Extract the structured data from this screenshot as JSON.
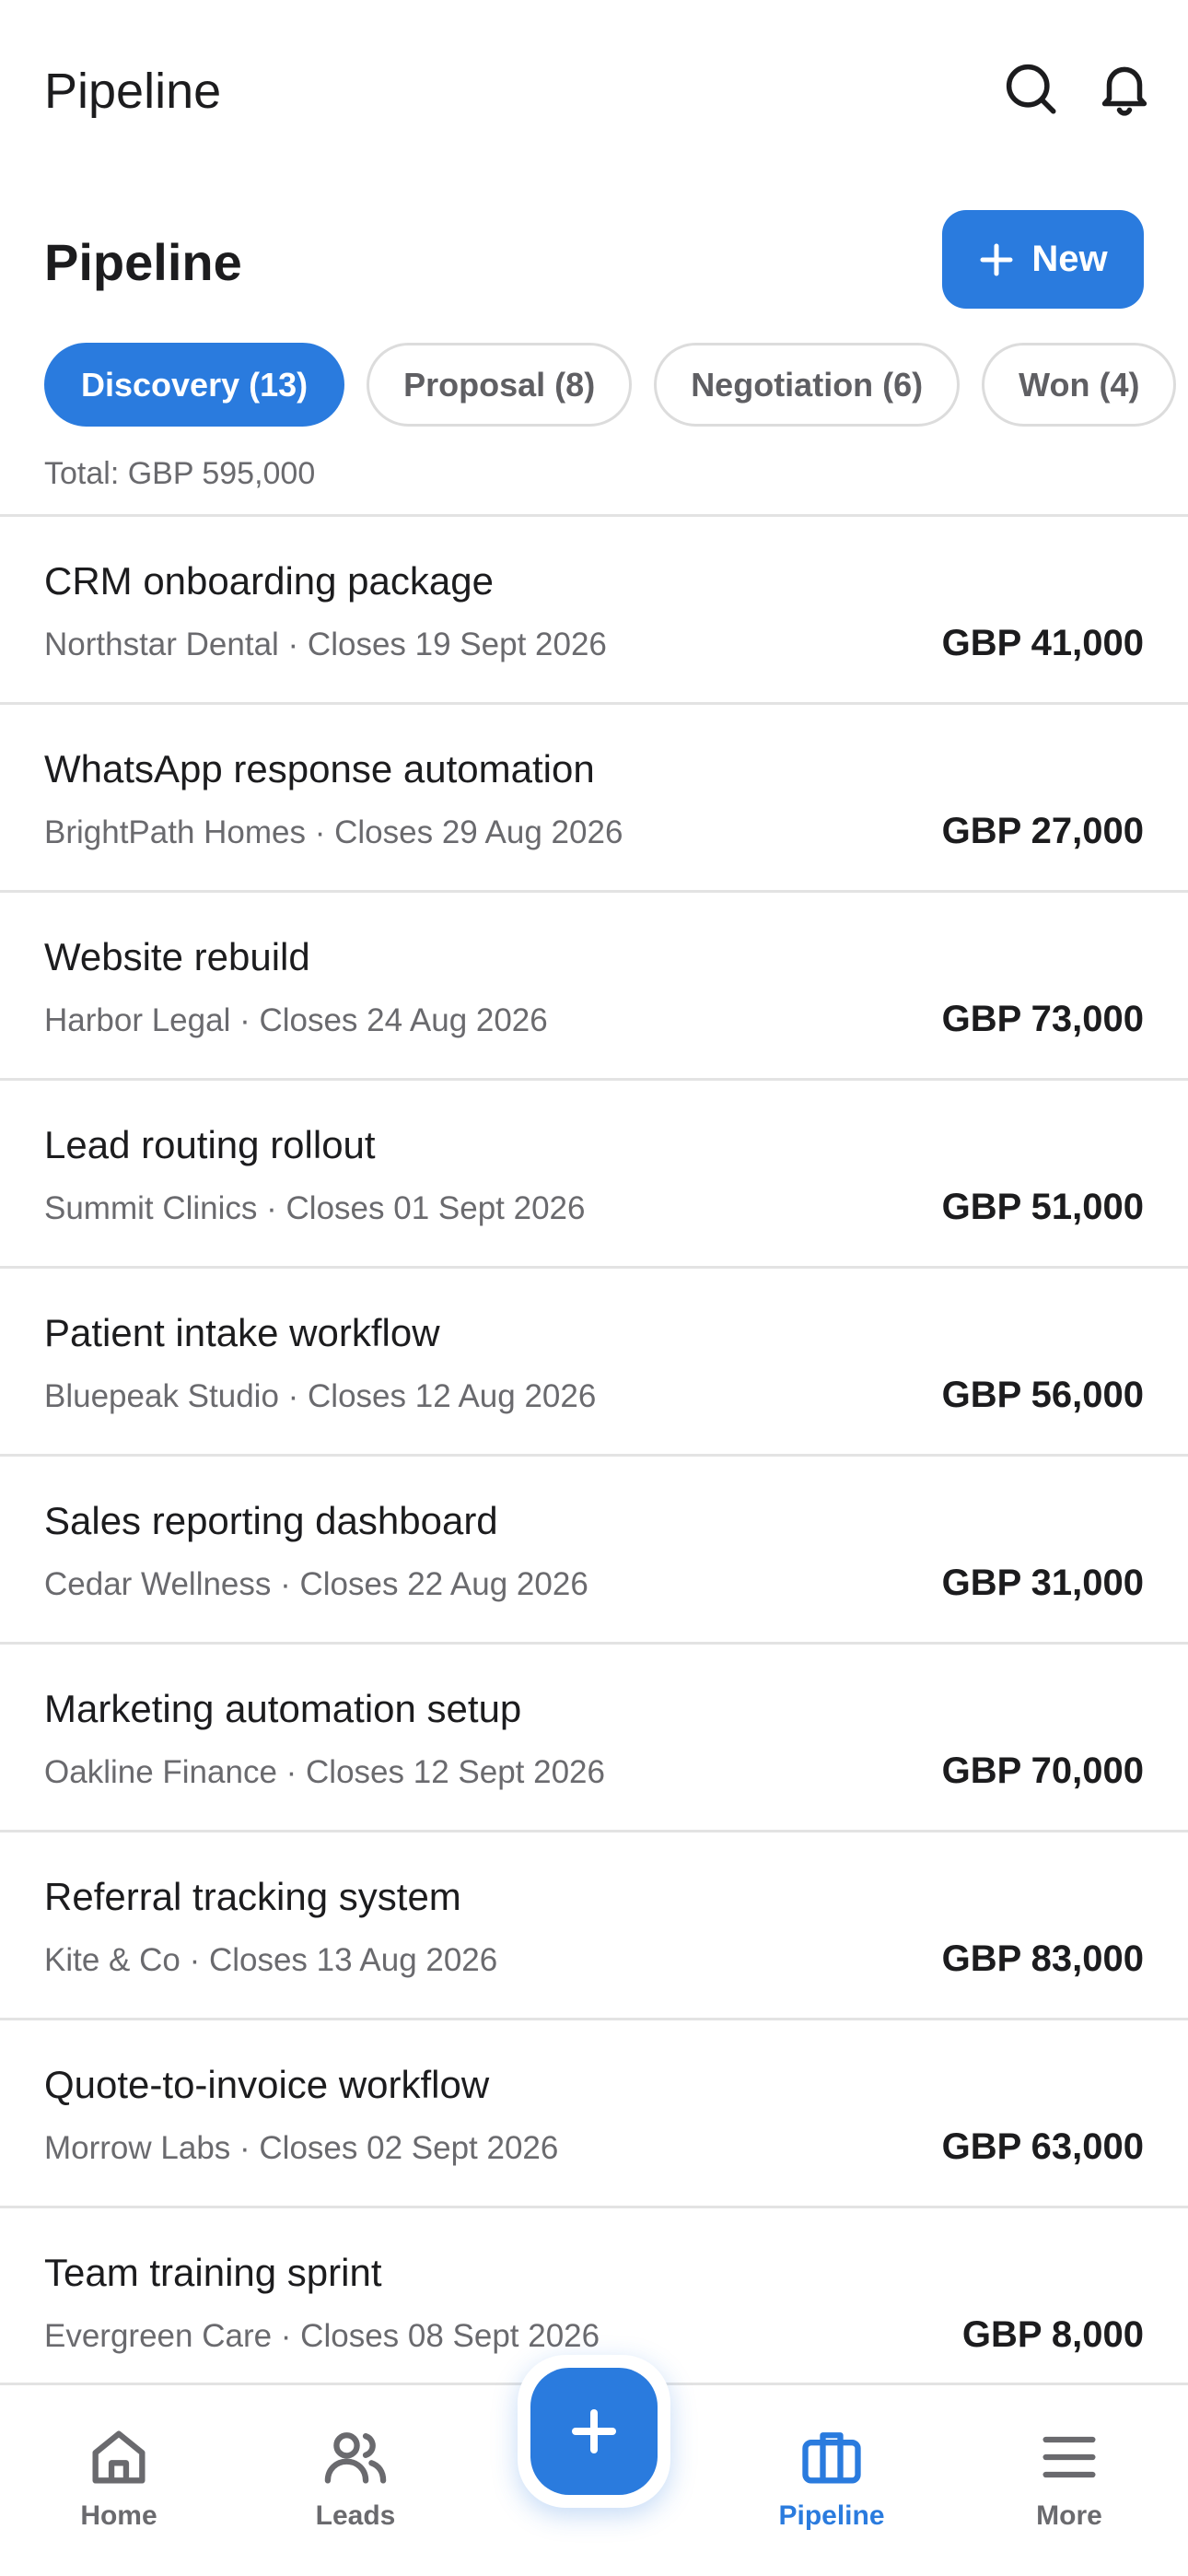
{
  "header": {
    "title": "Pipeline"
  },
  "section": {
    "title": "Pipeline",
    "new_label": "New"
  },
  "filters": [
    {
      "label": "Discovery (13)",
      "active": true
    },
    {
      "label": "Proposal (8)",
      "active": false
    },
    {
      "label": "Negotiation (6)",
      "active": false
    },
    {
      "label": "Won (4)",
      "active": false
    }
  ],
  "total": "Total: GBP 595,000",
  "deals": [
    {
      "title": "CRM onboarding package",
      "meta": "Northstar Dental · Closes 19 Sept 2026",
      "value": "GBP 41,000"
    },
    {
      "title": "WhatsApp response automation",
      "meta": "BrightPath Homes · Closes 29 Aug 2026",
      "value": "GBP 27,000"
    },
    {
      "title": "Website rebuild",
      "meta": "Harbor Legal · Closes 24 Aug 2026",
      "value": "GBP 73,000"
    },
    {
      "title": "Lead routing rollout",
      "meta": "Summit Clinics · Closes 01 Sept 2026",
      "value": "GBP 51,000"
    },
    {
      "title": "Patient intake workflow",
      "meta": "Bluepeak Studio · Closes 12 Aug 2026",
      "value": "GBP 56,000"
    },
    {
      "title": "Sales reporting dashboard",
      "meta": "Cedar Wellness · Closes 22 Aug 2026",
      "value": "GBP 31,000"
    },
    {
      "title": "Marketing automation setup",
      "meta": "Oakline Finance · Closes 12 Sept 2026",
      "value": "GBP 70,000"
    },
    {
      "title": "Referral tracking system",
      "meta": "Kite & Co · Closes 13 Aug 2026",
      "value": "GBP 83,000"
    },
    {
      "title": "Quote-to-invoice workflow",
      "meta": "Morrow Labs · Closes 02 Sept 2026",
      "value": "GBP 63,000"
    },
    {
      "title": "Team training sprint",
      "meta": "Evergreen Care · Closes 08 Sept 2026",
      "value": "GBP 8,000"
    }
  ],
  "nav": {
    "home": "Home",
    "leads": "Leads",
    "pipeline": "Pipeline",
    "more": "More",
    "active": "pipeline"
  },
  "colors": {
    "accent": "#2a7bde",
    "text": "#1c1c1e",
    "muted": "#6a6a6e",
    "divider": "#e3e3e3"
  },
  "icons": {
    "search": "search-icon",
    "bell": "bell-icon",
    "new": "plus-icon",
    "home": "home-icon",
    "leads": "users-icon",
    "add": "plus-icon",
    "pipeline": "briefcase-icon",
    "more": "menu-icon"
  }
}
